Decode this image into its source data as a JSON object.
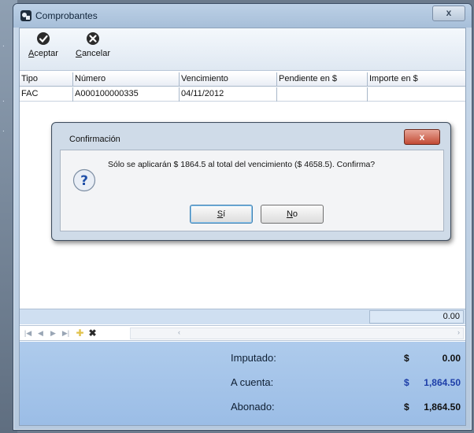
{
  "window": {
    "title": "Comprobantes",
    "close_glyph": "x"
  },
  "toolbar": {
    "accept": {
      "prefix": "A",
      "rest": "ceptar",
      "icon": "check-circle-icon"
    },
    "cancel": {
      "prefix": "C",
      "rest": "ancelar",
      "icon": "x-circle-icon"
    }
  },
  "grid": {
    "columns": [
      "Tipo",
      "Número",
      "Vencimiento",
      "Pendiente en $",
      "Importe en $"
    ],
    "rows": [
      [
        "FAC",
        "A000100000335",
        "04/11/2012",
        "",
        ""
      ]
    ],
    "total": "0.00"
  },
  "summary": {
    "imputado": {
      "label": "Imputado:",
      "currency": "$",
      "value": "0.00",
      "color": "#111111"
    },
    "a_cuenta": {
      "label": "A cuenta:",
      "currency": "$",
      "value": "1,864.50",
      "color": "#1d3ea8"
    },
    "abonado": {
      "label": "Abonado:",
      "currency": "$",
      "value": "1,864.50",
      "color": "#111111"
    }
  },
  "dialog": {
    "title": "Confirmación",
    "close_glyph": "x",
    "message": "Sólo se aplicarán $  1864.5 al total del vencimiento ($  4658.5). Confirma?",
    "yes": {
      "prefix": "S",
      "rest": "í"
    },
    "no": {
      "prefix": "N",
      "rest": "o"
    }
  }
}
